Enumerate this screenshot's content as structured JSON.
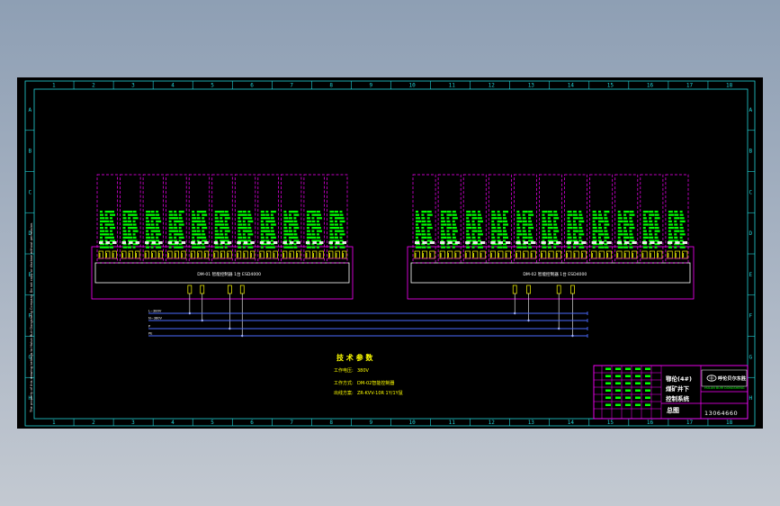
{
  "drawing": {
    "column_numbers": [
      "1",
      "2",
      "3",
      "4",
      "5",
      "6",
      "7",
      "8",
      "9",
      "10",
      "11",
      "12",
      "13",
      "14",
      "15",
      "16",
      "17",
      "18"
    ],
    "row_letters": [
      "A",
      "B",
      "C",
      "D",
      "E",
      "F",
      "G",
      "H"
    ],
    "left_margin_note": "The property of this drawing belongs to Hulun Buir Dongsheng Company. Do not copy or disclose without permission.",
    "panels": [
      {
        "header": "DM-01 智能控制器  1台  ESD4000"
      },
      {
        "header": "DM-02 智能控制器  1台  ESD4000"
      }
    ],
    "bus_labels": [
      "L~380V",
      "N~380V",
      "P",
      "PE"
    ],
    "tech_params": {
      "title": "技 术 参 数",
      "lines": [
        {
          "key": "工作电压:",
          "value": "380V"
        },
        {
          "key": "工作方式:",
          "value": "DM-02智能控制器"
        },
        {
          "key": "出线方案:",
          "value": "ZR-KVV-10R 1Y/1Y鼠"
        }
      ]
    },
    "title_block": {
      "company": "呼伦贝尔东胜",
      "company_en": "HULUN BUIR DONGSHENG",
      "project_lines": [
        "鄂伦(4#)",
        "煤矿井下",
        "控制系统"
      ],
      "drawing_type": "总图",
      "drawing_number": "13064660"
    }
  }
}
